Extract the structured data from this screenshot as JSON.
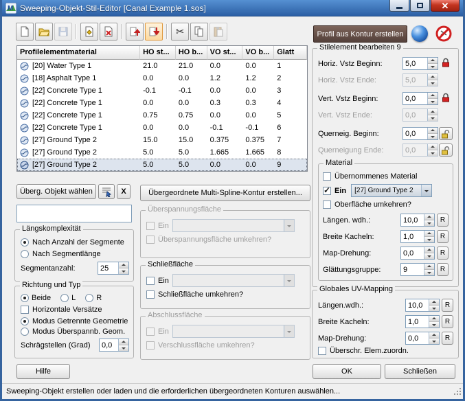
{
  "window": {
    "title": "Sweeping-Objekt-Stil-Editor [Canal Example 1.sos]",
    "status_text": "Sweeping-Objekt erstellen oder laden und die erforderlichen übergeordneten Konturen auswählen..."
  },
  "icons": {
    "app": "M-logo",
    "new_document": "blank-page",
    "open": "folder",
    "save": "floppy-disk",
    "add_element": "page-with-yellow-mark",
    "remove_element": "page-with-red-x",
    "move_up": "red-arrow-up",
    "move_down": "red-arrow-down",
    "cut": "✂",
    "copy": "two-pages",
    "paste": "clipboard",
    "sphere": "blue-sphere",
    "forbidden": "red-no-circle",
    "lock_closed": "red-padlock",
    "lock_open": "open-padlock",
    "dropdown_arrow": "▼",
    "spinner_up": "▲",
    "spinner_down": "▼",
    "resize_grip": "diagonal-dots"
  },
  "toolbar": {
    "profile_from_contour_label": "Profil aus Kontur erstellen"
  },
  "profile_table": {
    "columns": [
      "Profilelementmaterial",
      "HO st...",
      "HO b...",
      "VO st...",
      "VO b...",
      "Glatt"
    ],
    "rows": [
      {
        "material": "[20] Water Type 1",
        "ho_st": "21.0",
        "ho_b": "21.0",
        "vo_st": "0.0",
        "vo_b": "0.0",
        "glatt": "1",
        "selected": false
      },
      {
        "material": "[18] Asphalt Type 1",
        "ho_st": "0.0",
        "ho_b": "0.0",
        "vo_st": "1.2",
        "vo_b": "1.2",
        "glatt": "2",
        "selected": false
      },
      {
        "material": "[22] Concrete Type 1",
        "ho_st": "-0.1",
        "ho_b": "-0.1",
        "vo_st": "0.0",
        "vo_b": "0.0",
        "glatt": "3",
        "selected": false
      },
      {
        "material": "[22] Concrete Type 1",
        "ho_st": "0.0",
        "ho_b": "0.0",
        "vo_st": "0.3",
        "vo_b": "0.3",
        "glatt": "4",
        "selected": false
      },
      {
        "material": "[22] Concrete Type 1",
        "ho_st": "0.75",
        "ho_b": "0.75",
        "vo_st": "0.0",
        "vo_b": "0.0",
        "glatt": "5",
        "selected": false
      },
      {
        "material": "[22] Concrete Type 1",
        "ho_st": "0.0",
        "ho_b": "0.0",
        "vo_st": "-0.1",
        "vo_b": "-0.1",
        "glatt": "6",
        "selected": false
      },
      {
        "material": "[27] Ground Type 2",
        "ho_st": "15.0",
        "ho_b": "15.0",
        "vo_st": "0.375",
        "vo_b": "0.375",
        "glatt": "7",
        "selected": false
      },
      {
        "material": "[27] Ground Type 2",
        "ho_st": "5.0",
        "ho_b": "5.0",
        "vo_st": "1.665",
        "vo_b": "1.665",
        "glatt": "8",
        "selected": false
      },
      {
        "material": "[27] Ground Type 2",
        "ho_st": "5.0",
        "ho_b": "5.0",
        "vo_st": "0.0",
        "vo_b": "0.0",
        "glatt": "9",
        "selected": true
      }
    ]
  },
  "stilelement": {
    "title": "Stilelement bearbeiten 9",
    "rows": [
      {
        "label": "Horiz. Vstz Beginn:",
        "value": "5,0",
        "enabled": true,
        "lock": "closed"
      },
      {
        "label": "Horiz. Vstz Ende:",
        "value": "5,0",
        "enabled": false,
        "lock": "none"
      },
      {
        "label": "Vert. Vstz Beginn:",
        "value": "0,0",
        "enabled": true,
        "lock": "closed"
      },
      {
        "label": "Vert. Vstz Ende:",
        "value": "0,0",
        "enabled": false,
        "lock": "none"
      },
      {
        "label": "Querneig. Beginn:",
        "value": "0,0",
        "enabled": true,
        "lock": "open"
      },
      {
        "label": "Querneigung Ende:",
        "value": "0,0",
        "enabled": false,
        "lock": "open"
      }
    ],
    "material": {
      "title": "Material",
      "uebernommenes_label": "Übernommenes Material",
      "uebernommenes_checked": false,
      "ein_label": "Ein",
      "ein_checked": true,
      "material_select": "[27] Ground Type 2",
      "oberflaeche_label": "Oberfläche umkehren?",
      "oberflaeche_checked": false,
      "fields": [
        {
          "label": "Längen. wdh.:",
          "value": "10,0"
        },
        {
          "label": "Breite Kacheln:",
          "value": "1,0"
        },
        {
          "label": "Map-Drehung:",
          "value": "0,0"
        },
        {
          "label": "Glättungsgruppe:",
          "value": "9"
        }
      ],
      "reset_label": "R"
    }
  },
  "uv_mapping": {
    "title": "Globales UV-Mapping",
    "fields": [
      {
        "label": "Längen.wdh.:",
        "value": "10,0"
      },
      {
        "label": "Breite Kacheln:",
        "value": "1,0"
      },
      {
        "label": "Map-Drehung:",
        "value": "0,0"
      }
    ],
    "ueberschr_label": "Überschr. Elem.zuordn.",
    "ueberschr_checked": false,
    "reset_label": "R"
  },
  "parent_object": {
    "choose_label": "Überg. Objekt wählen",
    "clear_label": "X",
    "name_value": ""
  },
  "laengs": {
    "title": "Längskomplexität",
    "opt_segments": "Nach Anzahl der Segmente",
    "opt_segments_selected": true,
    "opt_length": "Nach Segmentlänge",
    "opt_length_selected": false,
    "count_label": "Segmentanzahl:",
    "count_value": "25"
  },
  "richtung": {
    "title": "Richtung und Typ",
    "beide": "Beide",
    "beide_selected": true,
    "links": "L",
    "links_selected": false,
    "rechts": "R",
    "rechts_selected": false,
    "horiz_label": "Horizontale Versätze",
    "horiz_checked": false,
    "modus_getrennt": "Modus Getrennte Geometrie",
    "modus_getrennt_selected": true,
    "modus_ueberspannb": "Modus Überspannb. Geom.",
    "modus_ueberspannb_selected": false,
    "schraeg_label": "Schrägstellen (Grad)",
    "schraeg_value": "0,0"
  },
  "konturen": {
    "multispline_label": "Übergeordnete Multi-Spline-Kontur erstellen...",
    "ueberspannung": {
      "title": "Überspannungsfläche",
      "ein": "Ein",
      "ein_checked": false,
      "umkehren": "Überspannungsfläche umkehren?",
      "enabled": false
    },
    "schliess": {
      "title": "Schließfläche",
      "ein": "Ein",
      "ein_checked": false,
      "umkehren": "Schließfläche umkehren?",
      "enabled": true
    },
    "abschluss": {
      "title": "Abschlussfläche",
      "ein": "Ein",
      "ein_checked": false,
      "umkehren": "Verschlussfläche umkehren?",
      "enabled": false
    }
  },
  "footer": {
    "hilfe": "Hilfe",
    "ok": "OK",
    "schliessen": "Schließen"
  }
}
